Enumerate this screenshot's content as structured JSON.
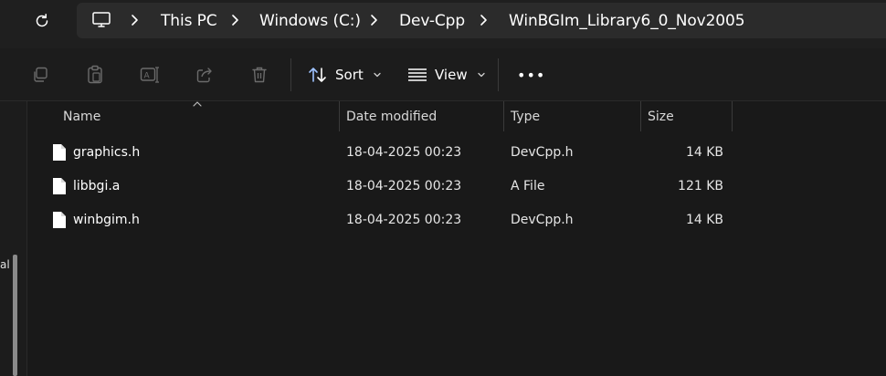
{
  "breadcrumb": {
    "items": [
      "This PC",
      "Windows (C:)",
      "Dev-Cpp",
      "WinBGIm_Library6_0_Nov2005"
    ]
  },
  "toolbar": {
    "sort_label": "Sort",
    "view_label": "View",
    "more_label": "•••"
  },
  "left_nav": {
    "cut_text": "al"
  },
  "columns": {
    "name": "Name",
    "date": "Date modified",
    "type": "Type",
    "size": "Size"
  },
  "files": [
    {
      "name": "graphics.h",
      "date": "18-04-2025 00:23",
      "type": "DevCpp.h",
      "size": "14 KB"
    },
    {
      "name": "libbgi.a",
      "date": "18-04-2025 00:23",
      "type": "A File",
      "size": "121 KB"
    },
    {
      "name": "winbgim.h",
      "date": "18-04-2025 00:23",
      "type": "DevCpp.h",
      "size": "14 KB"
    }
  ],
  "colors": {
    "background": "#191919",
    "address_box": "#2b2b2b",
    "toolbar_icon_disabled": "#6b6b6b",
    "accent_sort": "#9ec2ff"
  }
}
